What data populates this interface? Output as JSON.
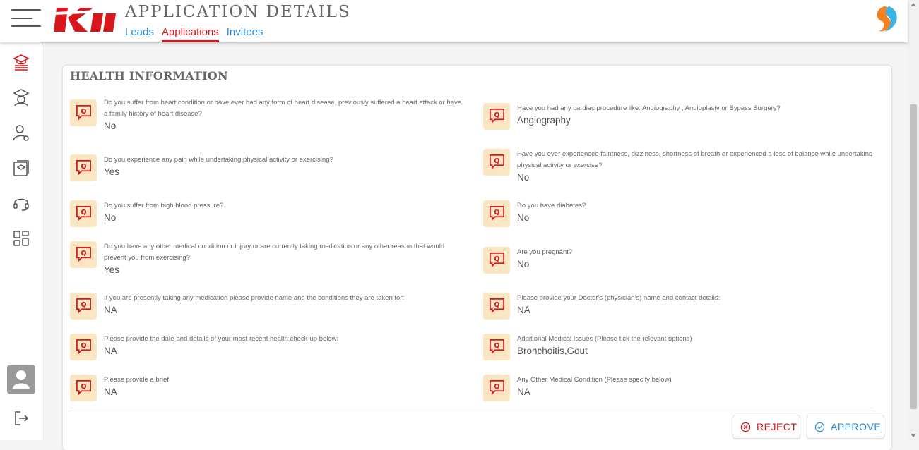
{
  "header": {
    "logo_text": "Kii",
    "title": "APPLICATION DETAILS",
    "tabs": [
      {
        "label": "Leads",
        "active": false
      },
      {
        "label": "Applications",
        "active": true
      },
      {
        "label": "Invitees",
        "active": false
      }
    ],
    "accent_color": "#d8161b",
    "link_color": "#2a8bd6"
  },
  "sidebar": {
    "items": [
      {
        "icon": "graduation-stack-icon",
        "active": true
      },
      {
        "icon": "student-icon"
      },
      {
        "icon": "user-settings-icon"
      },
      {
        "icon": "courses-icon"
      },
      {
        "icon": "headset-icon"
      },
      {
        "icon": "grid-icon"
      }
    ],
    "bottom": [
      "avatar",
      "logout-icon"
    ]
  },
  "section": {
    "title": "HEALTH INFORMATION",
    "questions": [
      {
        "q": "Do you suffer from heart condition or have ever had any form of heart disease, previously suffered a heart attack or have a family history of heart disease?",
        "a": "No"
      },
      {
        "q": "Have you had any cardiac procedure like: Angiography , Angioplasty or Bypass Surgery?",
        "a": "Angiography"
      },
      {
        "q": "Do you experience any pain while undertaking physical activity or exercising?",
        "a": "Yes"
      },
      {
        "q": "Have you ever experienced faintness, dizziness, shortness of breath or experienced a loss of balance while undertaking physical activity or exercise?",
        "a": "No"
      },
      {
        "q": "Do you suffer from high blood pressure?",
        "a": "No"
      },
      {
        "q": "Do you have diabetes?",
        "a": "No"
      },
      {
        "q": "Do you have any other medical condition or injury or are currently taking medication or any other reason that would prevent you from exercising?",
        "a": "Yes"
      },
      {
        "q": "Are you pregnant?",
        "a": "No"
      },
      {
        "q": "If you are presently taking any medication please provide name and the conditions they are taken for:",
        "a": "NA"
      },
      {
        "q": "Please provide your Doctor's (physician's) name and contact details:",
        "a": "NA"
      },
      {
        "q": "Please provide the date and details of your most recent health check-up below:",
        "a": "NA"
      },
      {
        "q": "Additional Medical Issues (Please tick the relevant options)",
        "a": "Bronchoitis,Gout"
      },
      {
        "q": "Please provide a brief",
        "a": "NA"
      },
      {
        "q": "Any Other Medical Condition (Please specify below)",
        "a": "NA"
      }
    ]
  },
  "actions": {
    "reject_label": "REJECT",
    "approve_label": "APPROVE"
  }
}
